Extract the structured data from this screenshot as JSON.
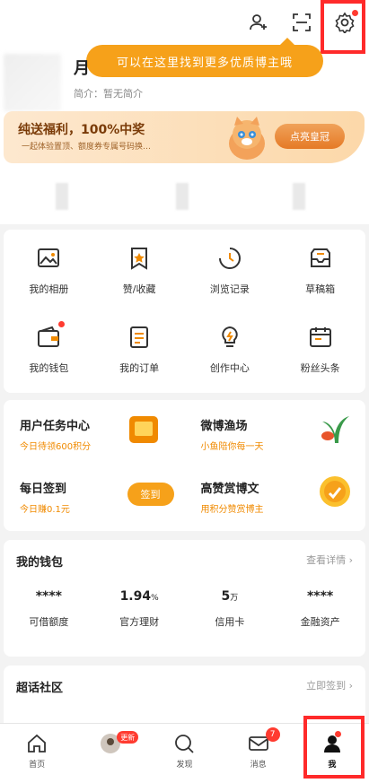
{
  "tooltip": {
    "text": "可以在这里找到更多优质博主哦"
  },
  "profile": {
    "name": "月",
    "bio": "简介：暂无简介"
  },
  "promo": {
    "title": "纯送福利，100%中奖",
    "subtitle": "一起体验置顶、额度券专属号码换…",
    "button": "点亮皇冠"
  },
  "features": [
    {
      "label": "我的相册",
      "icon": "photo-icon"
    },
    {
      "label": "赞/收藏",
      "icon": "star-bookmark-icon"
    },
    {
      "label": "浏览记录",
      "icon": "clock-icon"
    },
    {
      "label": "草稿箱",
      "icon": "inbox-icon"
    },
    {
      "label": "我的钱包",
      "icon": "wallet-icon"
    },
    {
      "label": "我的订单",
      "icon": "order-list-icon"
    },
    {
      "label": "创作中心",
      "icon": "bulb-icon"
    },
    {
      "label": "粉丝头条",
      "icon": "calendar-icon"
    }
  ],
  "tasks": [
    {
      "title": "用户任务中心",
      "sub": "今日待领600积分"
    },
    {
      "title": "微博渔场",
      "sub": "小鱼陪你每一天"
    },
    {
      "title": "每日签到",
      "sub": "今日赚0.1元",
      "button": "签到"
    },
    {
      "title": "高赞赏博文",
      "sub": "用积分赞赏博主"
    }
  ],
  "wallet": {
    "title": "我的钱包",
    "link": "查看详情",
    "items": [
      {
        "value": "****",
        "unit": "",
        "label": "可借额度"
      },
      {
        "value": "1.94",
        "unit": "%",
        "label": "官方理财"
      },
      {
        "value": "5",
        "unit": "万",
        "label": "信用卡"
      },
      {
        "value": "****",
        "unit": "",
        "label": "金融资产"
      }
    ]
  },
  "community": {
    "title": "超话社区",
    "link": "立即签到"
  },
  "tabbar": [
    {
      "label": "首页",
      "icon": "home-icon"
    },
    {
      "label": "",
      "icon": "avatar-icon",
      "badge": "更新"
    },
    {
      "label": "发现",
      "icon": "search-icon"
    },
    {
      "label": "消息",
      "icon": "mail-icon",
      "badge": "7"
    },
    {
      "label": "我",
      "icon": "person-icon"
    }
  ],
  "colors": {
    "accent": "#f6a11a",
    "highlight": "#ff2a2a",
    "badge": "#ff3b30"
  }
}
